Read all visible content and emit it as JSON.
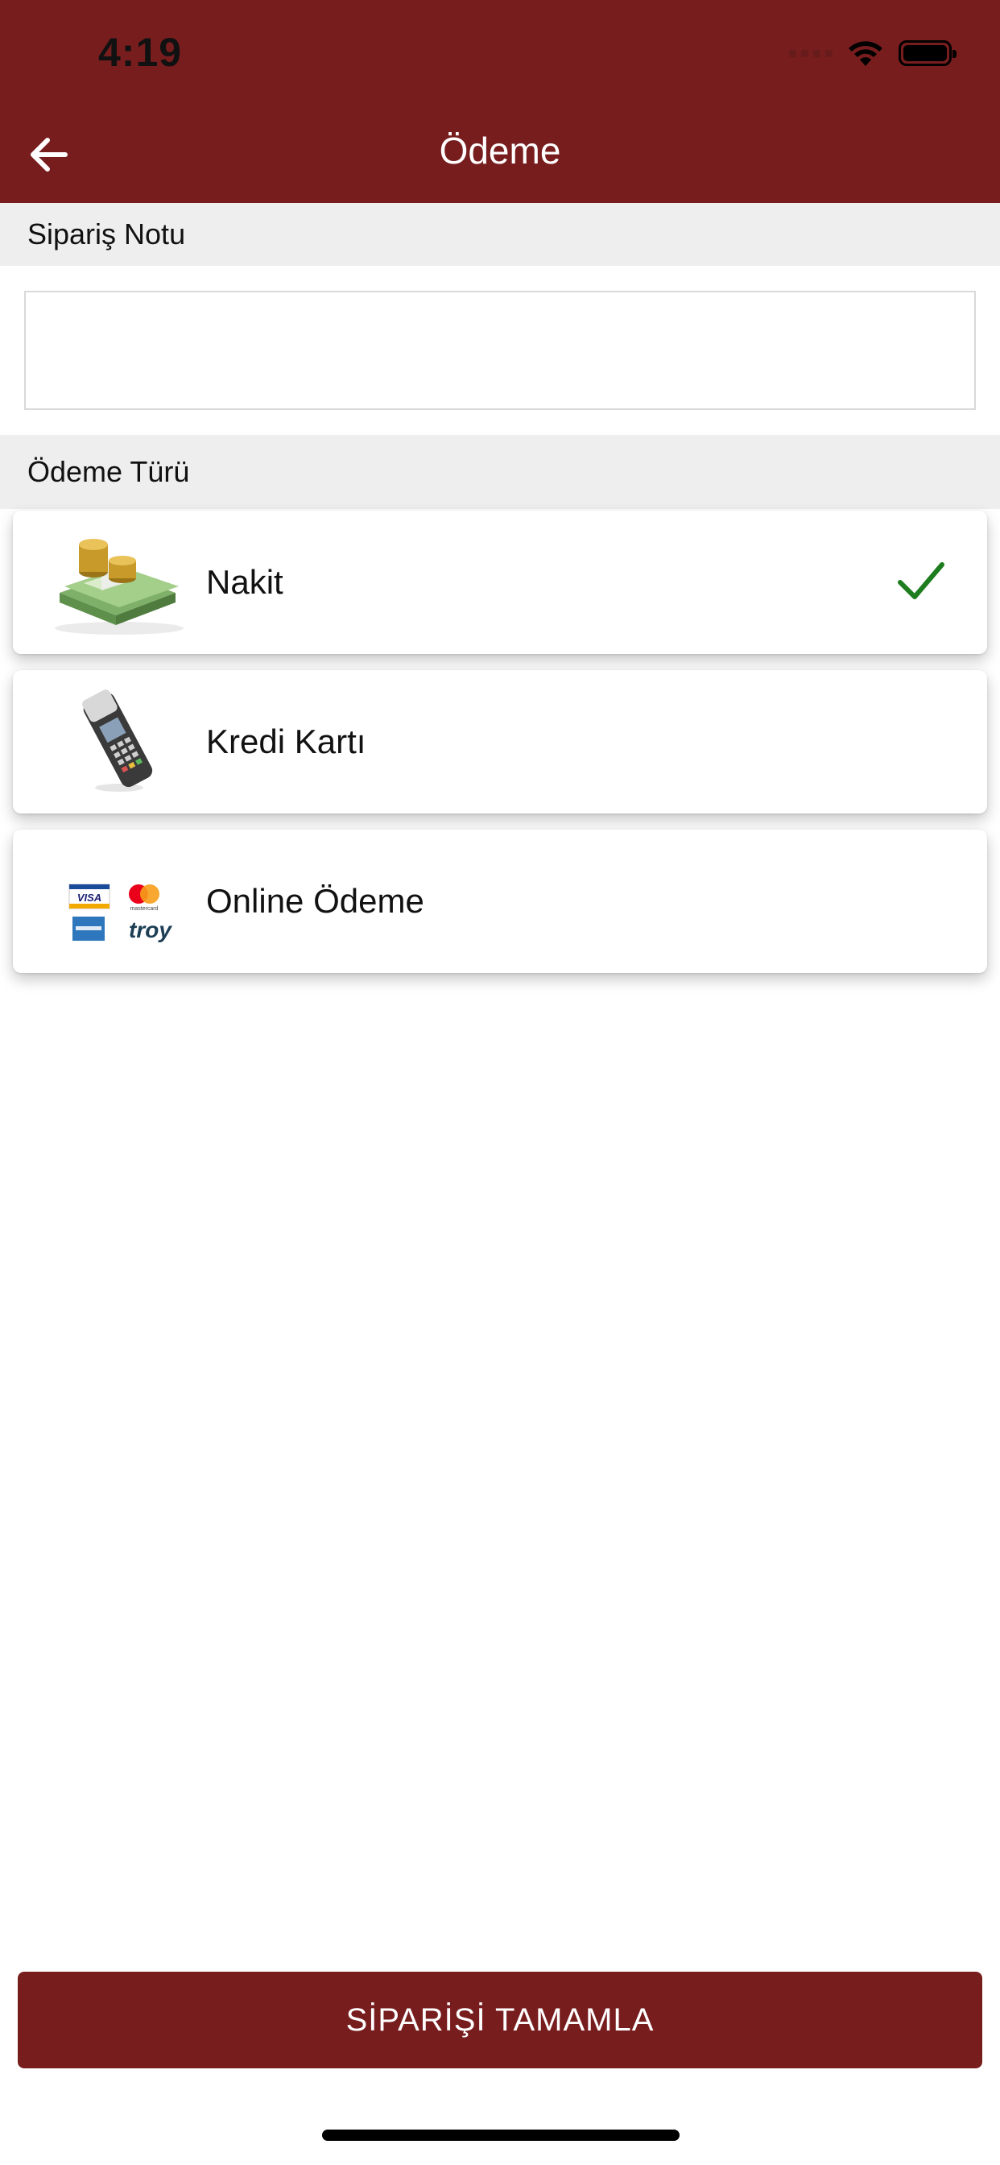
{
  "status_bar": {
    "time": "4:19"
  },
  "header": {
    "title": "Ödeme",
    "back_icon": "arrow-left-icon"
  },
  "order_note": {
    "label": "Sipariş Notu",
    "value": ""
  },
  "payment_type": {
    "label": "Ödeme Türü",
    "options": [
      {
        "label": "Nakit",
        "icon": "cash-money-icon",
        "selected": true
      },
      {
        "label": "Kredi Kartı",
        "icon": "pos-terminal-icon",
        "selected": false
      },
      {
        "label": "Online Ödeme",
        "icon": "card-brands-icon",
        "selected": false
      }
    ]
  },
  "card_brand_text": {
    "visa": "VISA",
    "mastercard": "mastercard",
    "troy": "troy"
  },
  "footer": {
    "complete_button": "SİPARİŞİ TAMAMLA"
  },
  "colors": {
    "primary": "#781d1e",
    "check": "#1e7d1e",
    "section_bg": "#eeeeee"
  }
}
